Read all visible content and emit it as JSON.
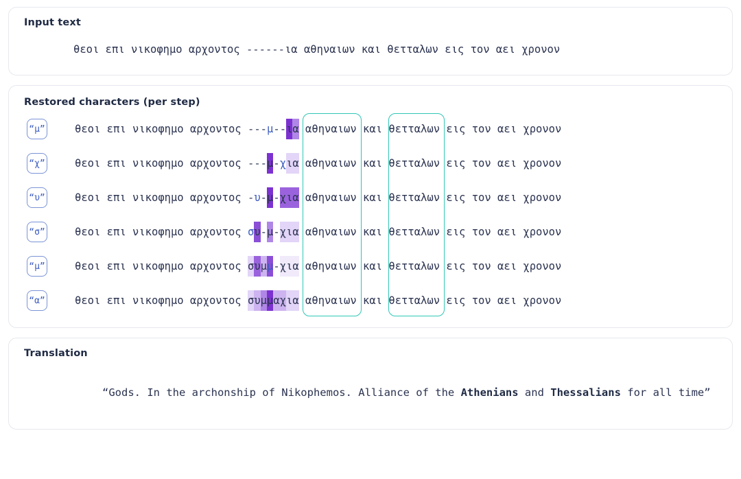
{
  "input_section": {
    "title": "Input text",
    "text": "θεοι επι νικοφημο αρχοντος ------ια αθηναιων και θετταλων εις τον αει χρονον"
  },
  "restored_section": {
    "title": "Restored characters (per step)",
    "prefix": "θεοι επι νικοφημο αρχοντος ",
    "suffix_a": " αθηναιων",
    "suffix_b": " και ",
    "suffix_c": "θετταλων",
    "suffix_d": " εις τον αει χρονον",
    "steps": [
      {
        "badge": "“μ”",
        "predicted_char": "μ",
        "gap": "---μ--ια",
        "chars": [
          {
            "c": "-",
            "level": 0,
            "predicted": false
          },
          {
            "c": "-",
            "level": 0,
            "predicted": false
          },
          {
            "c": "-",
            "level": 0,
            "predicted": false
          },
          {
            "c": "μ",
            "level": 0,
            "predicted": true
          },
          {
            "c": "-",
            "level": 0,
            "predicted": false
          },
          {
            "c": "-",
            "level": 0,
            "predicted": false
          },
          {
            "c": "ι",
            "level": 7,
            "predicted": false
          },
          {
            "c": "α",
            "level": 4,
            "predicted": false
          }
        ],
        "left_glow": [
          {
            "c": " ",
            "level": 0
          },
          {
            "c": " ",
            "level": 0
          }
        ]
      },
      {
        "badge": "“χ”",
        "predicted_char": "χ",
        "gap": "---μ-χια",
        "chars": [
          {
            "c": "-",
            "level": 0,
            "predicted": false
          },
          {
            "c": "-",
            "level": 0,
            "predicted": false
          },
          {
            "c": "-",
            "level": 0,
            "predicted": false
          },
          {
            "c": "μ",
            "level": 7,
            "predicted": false
          },
          {
            "c": "-",
            "level": 0,
            "predicted": false
          },
          {
            "c": "χ",
            "level": 0,
            "predicted": true
          },
          {
            "c": "ι",
            "level": 2,
            "predicted": false
          },
          {
            "c": "α",
            "level": 2,
            "predicted": false
          }
        ]
      },
      {
        "badge": "“υ”",
        "predicted_char": "υ",
        "gap": "-υ-μ-χια",
        "chars": [
          {
            "c": "-",
            "level": 0,
            "predicted": false
          },
          {
            "c": "υ",
            "level": 0,
            "predicted": true
          },
          {
            "c": "-",
            "level": 0,
            "predicted": false
          },
          {
            "c": "μ",
            "level": 7,
            "predicted": false
          },
          {
            "c": "-",
            "level": 0,
            "predicted": false
          },
          {
            "c": "χ",
            "level": 5,
            "predicted": false
          },
          {
            "c": "ι",
            "level": 5,
            "predicted": false
          },
          {
            "c": "α",
            "level": 5,
            "predicted": false
          }
        ]
      },
      {
        "badge": "“σ”",
        "predicted_char": "σ",
        "gap": "συ-μ-χια",
        "chars": [
          {
            "c": "σ",
            "level": 0,
            "predicted": true
          },
          {
            "c": "υ",
            "level": 6,
            "predicted": false
          },
          {
            "c": "-",
            "level": 0,
            "predicted": false
          },
          {
            "c": "μ",
            "level": 4,
            "predicted": false
          },
          {
            "c": "-",
            "level": 0,
            "predicted": false
          },
          {
            "c": "χ",
            "level": 2,
            "predicted": false
          },
          {
            "c": "ι",
            "level": 2,
            "predicted": false
          },
          {
            "c": "α",
            "level": 2,
            "predicted": false
          }
        ]
      },
      {
        "badge": "“μ”",
        "predicted_char": "μ",
        "gap": "συμμ-χια",
        "chars": [
          {
            "c": "σ",
            "level": 2,
            "predicted": false
          },
          {
            "c": "υ",
            "level": 5,
            "predicted": false
          },
          {
            "c": "μ",
            "level": 3,
            "predicted": false
          },
          {
            "c": "μ",
            "level": 6,
            "predicted": true
          },
          {
            "c": "-",
            "level": 0,
            "predicted": false
          },
          {
            "c": "χ",
            "level": 1,
            "predicted": false
          },
          {
            "c": "ι",
            "level": 1,
            "predicted": false
          },
          {
            "c": "α",
            "level": 1,
            "predicted": false
          }
        ]
      },
      {
        "badge": "“α”",
        "predicted_char": "α",
        "gap": "συμμαχια",
        "chars": [
          {
            "c": "σ",
            "level": 2,
            "predicted": false
          },
          {
            "c": "υ",
            "level": 3,
            "predicted": false
          },
          {
            "c": "μ",
            "level": 4,
            "predicted": false
          },
          {
            "c": "μ",
            "level": 7,
            "predicted": false
          },
          {
            "c": "α",
            "level": 3,
            "predicted": false
          },
          {
            "c": "χ",
            "level": 3,
            "predicted": false
          },
          {
            "c": "ι",
            "level": 2,
            "predicted": false
          },
          {
            "c": "α",
            "level": 2,
            "predicted": false
          }
        ]
      }
    ],
    "highlight_boxes": [
      {
        "label": "athenians-box",
        "word": "αθηναιων"
      },
      {
        "label": "thessalians-box",
        "word": "θετταλων"
      }
    ]
  },
  "translation_section": {
    "title": "Translation",
    "open_quote": "“Gods. In the archonship of Nikophemos. Alliance of the ",
    "bold_1": "Athenians",
    "middle": " and ",
    "bold_2": "Thessalians",
    "tail": " for all time”"
  },
  "colors": {
    "accent_purple": "#7c32d0",
    "predicted_blue": "#3b5bbf",
    "teal_box": "#2fc6b5",
    "text": "#2b3350",
    "card_border": "#e6e8ee"
  }
}
